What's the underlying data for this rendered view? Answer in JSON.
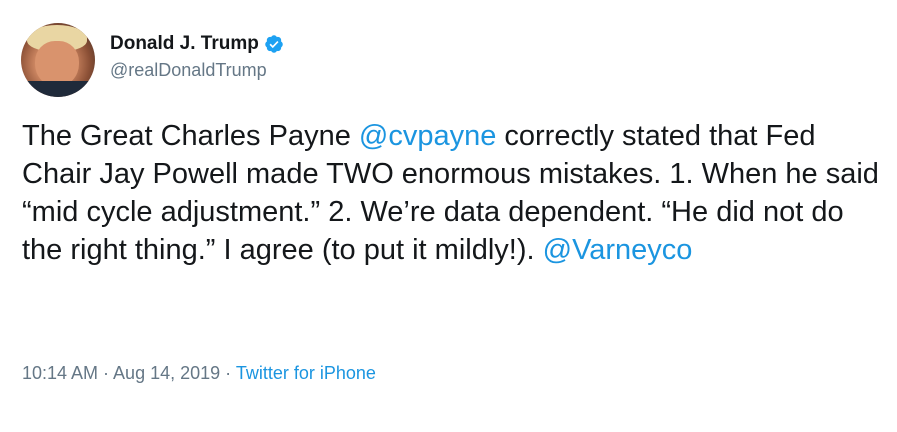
{
  "author": {
    "display_name": "Donald J. Trump",
    "handle": "@realDonaldTrump",
    "verified": true,
    "avatar_icon": "profile-photo"
  },
  "tweet": {
    "text_part1": "The Great Charles Payne ",
    "mention1": "@cvpayne",
    "text_part2": " correctly stated that Fed Chair Jay Powell made TWO enormous mistakes. 1. When he said “mid cycle adjustment.” 2. We’re data dependent.  “He did not do the right thing.” I agree (to put it mildly!). ",
    "mention2": "@Varneyco"
  },
  "meta": {
    "timestamp": "10:14 AM · Aug 14, 2019 · ",
    "source": "Twitter for iPhone"
  },
  "colors": {
    "link": "#1b95e0",
    "secondary_text": "#657786",
    "primary_text": "#14171a",
    "verified_badge": "#1da1f2"
  }
}
